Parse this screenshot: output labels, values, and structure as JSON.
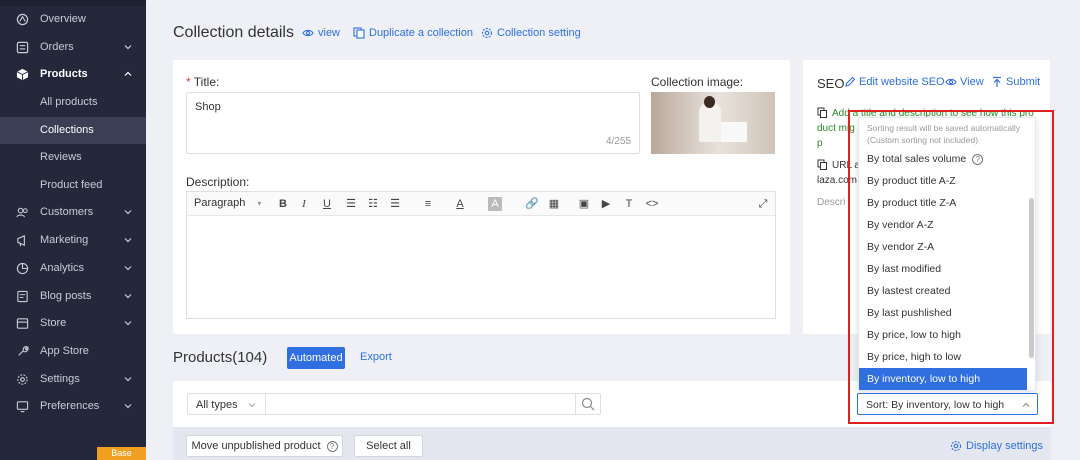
{
  "sidebar": {
    "items": [
      {
        "label": "Overview",
        "icon": "overview-icon",
        "chevron": false
      },
      {
        "label": "Orders",
        "icon": "orders-icon",
        "chevron": true
      },
      {
        "label": "Products",
        "icon": "box-icon",
        "chevron": true,
        "expanded": true
      },
      {
        "label": "Customers",
        "icon": "customers-icon",
        "chevron": true
      },
      {
        "label": "Marketing",
        "icon": "marketing-icon",
        "chevron": true
      },
      {
        "label": "Analytics",
        "icon": "analytics-icon",
        "chevron": true
      },
      {
        "label": "Blog posts",
        "icon": "blog-icon",
        "chevron": true
      },
      {
        "label": "Store",
        "icon": "store-icon",
        "chevron": true
      },
      {
        "label": "App Store",
        "icon": "app-store-icon",
        "chevron": false
      },
      {
        "label": "Settings",
        "icon": "gear-icon",
        "chevron": true
      },
      {
        "label": "Preferences",
        "icon": "preferences-icon",
        "chevron": true
      }
    ],
    "sub_items": [
      "All products",
      "Collections",
      "Reviews",
      "Product feed"
    ],
    "selected_sub": "Collections",
    "badge": "Base"
  },
  "header": {
    "title": "Collection details",
    "view_label": "view",
    "duplicate_label": "Duplicate a collection",
    "setting_label": "Collection setting"
  },
  "form": {
    "title_label": "Title",
    "title_value": "Shop",
    "title_counter": "4/255",
    "image_label": "Collection image",
    "description_label": "Description",
    "toolbar_paragraph": "Paragraph"
  },
  "seo": {
    "title": "SEO",
    "edit_label": "Edit website SEO",
    "view_label": "View",
    "submit_label": "Submit",
    "hint_line1": "Add a title and description to see how this pro",
    "hint_line2": "duct mig",
    "hint_line3": "p",
    "url_label": "URL a",
    "url_value": "laza.com",
    "desc_placeholder": "Descri"
  },
  "products": {
    "title": "Products(104)",
    "automated_label": "Automated",
    "export_label": "Export",
    "types_select": "All types",
    "move_unpublished_label": "Move unpublished product",
    "select_all_label": "Select all",
    "display_settings_label": "Display settings"
  },
  "sort_dropdown": {
    "hint_line1": "Sorting result will be saved automatically",
    "hint_line2": "(Custom sorting not included)",
    "options": [
      "By total sales volume",
      "By product title A-Z",
      "By product title Z-A",
      "By vendor A-Z",
      "By vendor Z-A",
      "By last modified",
      "By lastest created",
      "By last pushlished",
      "By price, low to high",
      "By price, high to low",
      "By inventory, low to high"
    ],
    "selected": "By inventory, low to high",
    "current_value": "Sort: By inventory, low to high"
  },
  "colors": {
    "accent": "#2f6fe0",
    "sidebar_bg": "#24283a",
    "highlight_frame": "#e02020",
    "badge": "#f0a020"
  }
}
